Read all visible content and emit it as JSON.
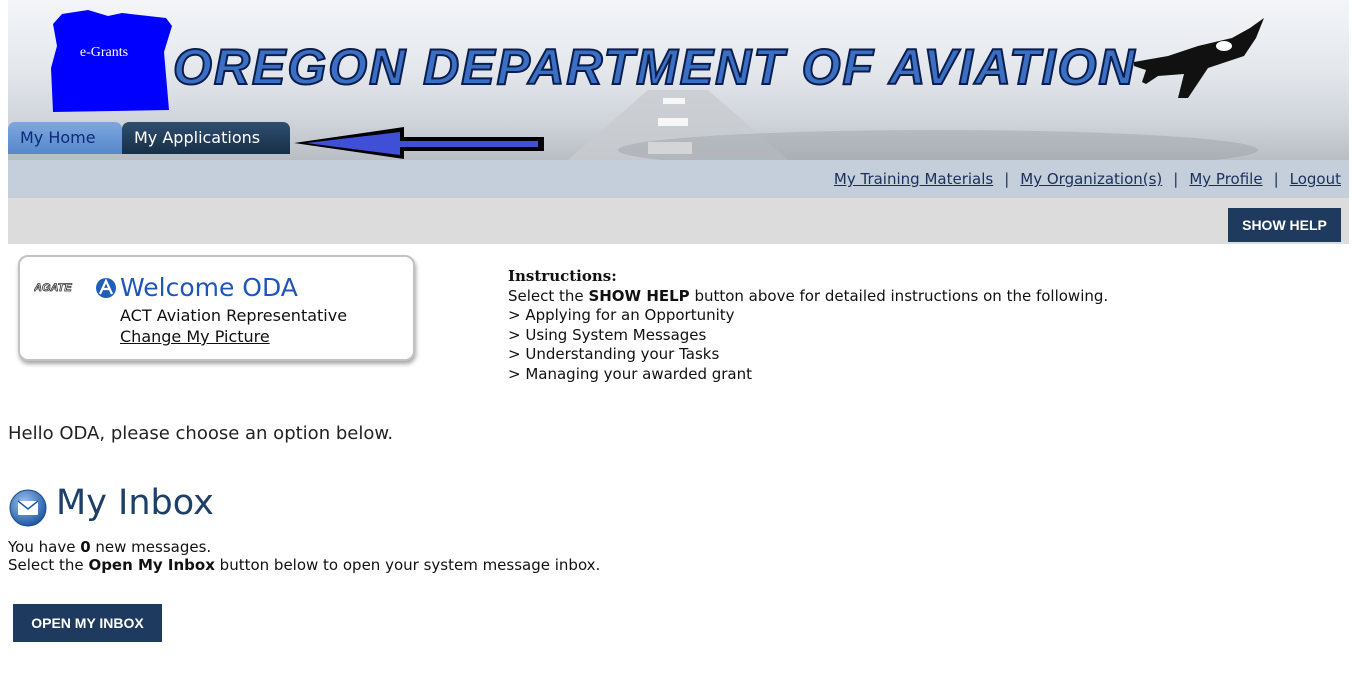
{
  "header": {
    "logo_text": "e-Grants",
    "title": "OREGON DEPARTMENT OF AVIATION"
  },
  "tabs": [
    {
      "label": "My Home"
    },
    {
      "label": "My Applications"
    }
  ],
  "nav": {
    "training": "My Training Materials",
    "organizations": "My Organization(s)",
    "profile": "My Profile",
    "logout": "Logout",
    "separator": "|"
  },
  "help_button": "SHOW HELP",
  "welcome": {
    "brand": "AGATE",
    "title": "Welcome ODA",
    "role": "ACT Aviation Representative",
    "change_picture": "Change My Picture"
  },
  "instructions": {
    "heading": "Instructions:",
    "line_prefix": "Select the ",
    "line_bold": "SHOW HELP",
    "line_suffix": " button above for detailed instructions on the following.",
    "items": [
      "> Applying for an Opportunity",
      "> Using System Messages",
      "> Understanding your Tasks",
      "> Managing your awarded grant"
    ]
  },
  "greeting": "Hello ODA, please choose an option below.",
  "inbox": {
    "title": "My Inbox",
    "msg_prefix": "You have ",
    "new_count": "0",
    "msg_suffix": " new messages.",
    "open_prefix": "Select the ",
    "open_bold": "Open My Inbox",
    "open_suffix": " button below to open your system message inbox.",
    "button": "OPEN MY INBOX"
  },
  "colors": {
    "brand_blue": "#0000ff",
    "dark_navy": "#1f3a5f",
    "nav_bg": "#c5cfdc"
  }
}
